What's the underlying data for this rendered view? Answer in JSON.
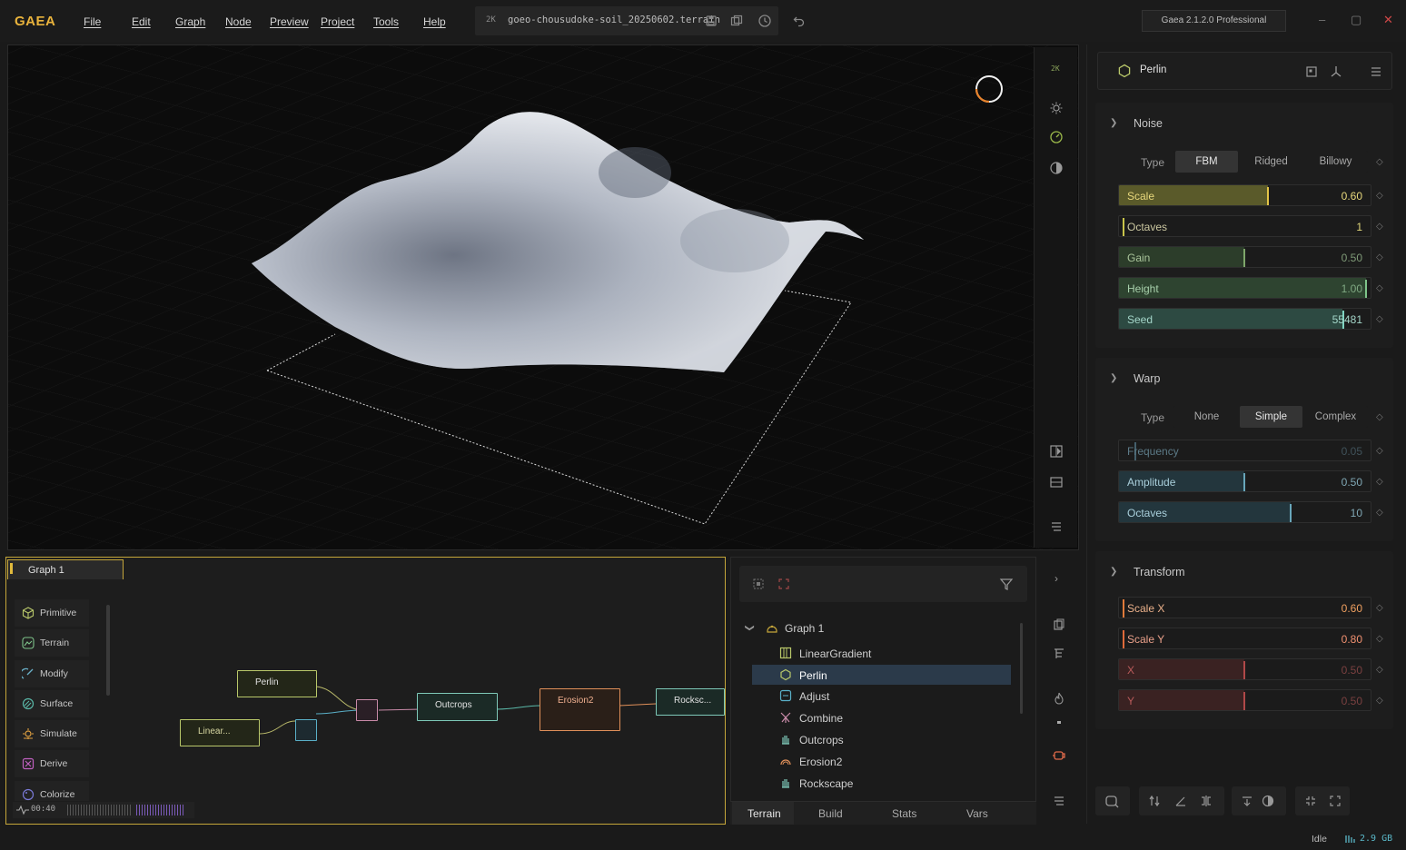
{
  "app": {
    "logo": "GAEA",
    "menu": [
      "File",
      "Edit",
      "Graph",
      "Node",
      "Preview",
      "Project",
      "Tools",
      "Help"
    ],
    "file_resolution": "2K",
    "filename": "goeo-chousudoke-soil_20250602.terrain",
    "version": "Gaea 2.1.2.0 Professional"
  },
  "viewport": {
    "resolution_label": "2K",
    "accent": "#e8822a"
  },
  "properties": {
    "node_name": "Perlin",
    "noise": {
      "title": "Noise",
      "type_label": "Type",
      "type_options": [
        "FBM",
        "Ridged",
        "Billowy"
      ],
      "type_selected": "FBM",
      "params": [
        {
          "label": "Scale",
          "value": "0.60",
          "fraction": 0.6
        },
        {
          "label": "Octaves",
          "value": "1",
          "fraction": 0.0
        },
        {
          "label": "Gain",
          "value": "0.50",
          "fraction": 0.5
        },
        {
          "label": "Height",
          "value": "1.00",
          "fraction": 1.0
        },
        {
          "label": "Seed",
          "value": "55481",
          "fraction": 0.9
        }
      ]
    },
    "warp": {
      "title": "Warp",
      "type_label": "Type",
      "type_options": [
        "None",
        "Simple",
        "Complex"
      ],
      "type_selected": "Simple",
      "params": [
        {
          "label": "Frequency",
          "value": "0.05",
          "fraction": 0.05
        },
        {
          "label": "Amplitude",
          "value": "0.50",
          "fraction": 0.5
        },
        {
          "label": "Octaves",
          "value": "10",
          "fraction": 0.7
        }
      ]
    },
    "transform": {
      "title": "Transform",
      "params": [
        {
          "label": "Scale X",
          "value": "0.60",
          "fraction": 0.0
        },
        {
          "label": "Scale Y",
          "value": "0.80",
          "fraction": 0.0
        },
        {
          "label": "X",
          "value": "0.50",
          "fraction": 0.5
        },
        {
          "label": "Y",
          "value": "0.50",
          "fraction": 0.5
        }
      ]
    }
  },
  "graph": {
    "tab": "Graph 1",
    "categories": [
      "Primitive",
      "Terrain",
      "Modify",
      "Surface",
      "Simulate",
      "Derive",
      "Colorize"
    ],
    "timer": "00:40",
    "nodes": {
      "perlin": "Perlin",
      "linear": "Linear...",
      "outcrops": "Outcrops",
      "erosion": "Erosion2",
      "rockscape": "Rocksc..."
    }
  },
  "layers": {
    "root": "Graph 1",
    "items": [
      "LinearGradient",
      "Perlin",
      "Adjust",
      "Combine",
      "Outcrops",
      "Erosion2",
      "Rockscape"
    ],
    "selected": "Perlin",
    "tabs": [
      "Terrain",
      "Build",
      "Stats",
      "Vars"
    ],
    "active_tab": "Terrain"
  },
  "status": {
    "state": "Idle",
    "memory": "2.9 GB"
  }
}
